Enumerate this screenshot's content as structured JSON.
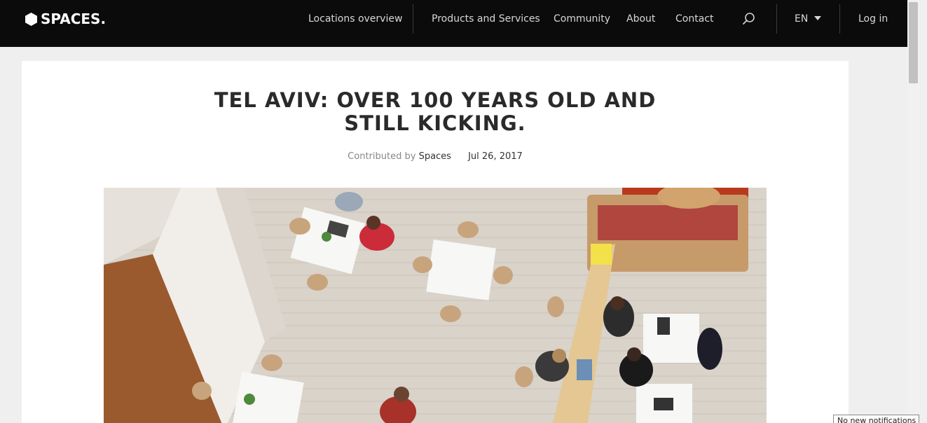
{
  "brand": {
    "name": "SPACES."
  },
  "nav": {
    "locations": "Locations overview",
    "products": "Products and Services",
    "community": "Community",
    "about": "About",
    "contact": "Contact",
    "language": "EN",
    "login": "Log in"
  },
  "article": {
    "title": "TEL AVIV: OVER 100 YEARS OLD AND STILL KICKING.",
    "contributed_prefix": "Contributed by",
    "author": "Spaces",
    "date": "Jul 26, 2017"
  },
  "notification": {
    "text": "No new notifications"
  },
  "colors": {
    "navbar": "#0b0b0b",
    "page_bg": "#efefef",
    "card_bg": "#ffffff",
    "title": "#2a2a2a"
  }
}
